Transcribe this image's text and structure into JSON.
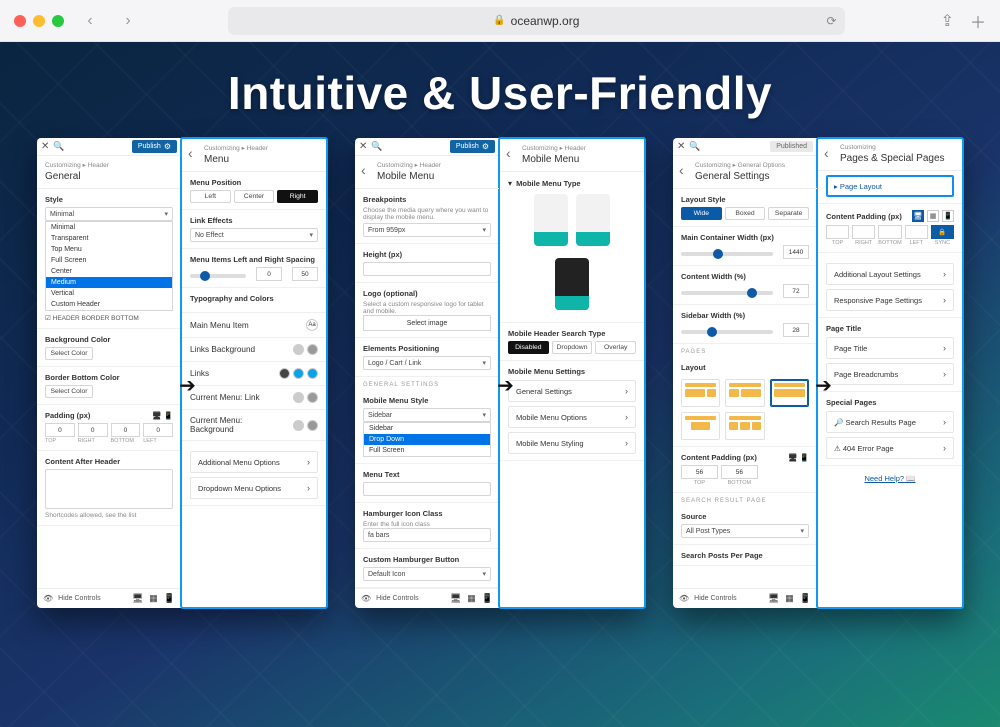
{
  "chrome": {
    "url_host": "oceanwp.org"
  },
  "hero": "Intuitive & User-Friendly",
  "board1": {
    "left": {
      "publish": "Publish",
      "crumb_path": "Customizing ▸ Header",
      "crumb_title": "General",
      "style_label": "Style",
      "style_value": "Minimal",
      "style_options": [
        "Minimal",
        "Transparent",
        "Top Menu",
        "Full Screen",
        "Center",
        "Medium",
        "Vertical",
        "Custom Header"
      ],
      "style_selected": "Medium",
      "checkbox": "HEADER BORDER BOTTOM",
      "bg_label": "Background Color",
      "bg_btn": "Select Color",
      "bb_label": "Border Bottom Color",
      "bb_btn": "Select Color",
      "pad_label": "Padding (px)",
      "pad_values": [
        "0",
        "0",
        "0",
        "0"
      ],
      "pad_sides": [
        "TOP",
        "RIGHT",
        "BOTTOM",
        "LEFT"
      ],
      "after_header": "Content After Header",
      "shortcodes": "Shortcodes allowed, see the list"
    },
    "right": {
      "crumb_path": "Customizing ▸ Header",
      "crumb_title": "Menu",
      "pos_label": "Menu Position",
      "pos_options": [
        "Left",
        "Center",
        "Right"
      ],
      "link_eff": "Link Effects",
      "link_eff_value": "No Effect",
      "spacing": "Menu Items Left and Right Spacing",
      "spacing_min": "0",
      "spacing_max": "50",
      "typo": "Typography and Colors",
      "main_item": "Main Menu Item",
      "links_bg": "Links Background",
      "links": "Links",
      "cur_link": "Current Menu: Link",
      "cur_bg": "Current Menu: Background",
      "add_menu": "Additional Menu Options",
      "drop_menu": "Dropdown Menu Options"
    },
    "footer": "Hide Controls"
  },
  "board2": {
    "left": {
      "publish": "Publish",
      "crumb_path": "Customizing ▸ Header",
      "crumb_title": "Mobile Menu",
      "break_label": "Breakpoints",
      "break_desc": "Choose the media query where you want to display the mobile menu.",
      "break_value": "From 959px",
      "height": "Height (px)",
      "logo": "Logo (optional)",
      "logo_desc": "Select a custom responsive logo for tablet and mobile.",
      "logo_btn": "Select image",
      "elem_pos": "Elements Positioning",
      "elem_value": "Logo / Cart / Link",
      "general": "GENERAL SETTINGS",
      "style_label": "Mobile Menu Style",
      "style_value": "Sidebar",
      "style_options": [
        "Sidebar",
        "Drop Down",
        "Full Screen"
      ],
      "style_selected": "Drop Down",
      "menu_text": "Menu Text",
      "ham": "Hamburger Icon Class",
      "ham_desc": "Enter the full icon class",
      "ham_value": "fa bars",
      "custom_ham": "Custom Hamburger Button",
      "custom_ham_value": "Default Icon"
    },
    "right": {
      "crumb_path": "Customizing ▸ Header",
      "crumb_title": "Mobile Menu",
      "menu_type": "Mobile Menu Type",
      "search_type": "Mobile Header Search Type",
      "search_opts": [
        "Disabled",
        "Dropdown",
        "Overlay"
      ],
      "settings": "Mobile Menu Settings",
      "links": [
        "General Settings",
        "Mobile Menu Options",
        "Mobile Menu Styling"
      ]
    },
    "footer": "Hide Controls"
  },
  "board3": {
    "left": {
      "published": "Published",
      "crumb_path": "Customizing ▸ General Options",
      "crumb_title": "General Settings",
      "layout_style": "Layout Style",
      "layout_opts": [
        "Wide",
        "Boxed",
        "Separate"
      ],
      "main_w": "Main Container Width (px)",
      "main_w_val": "1440",
      "cont_w": "Content Width (%)",
      "cont_w_val": "72",
      "side_w": "Sidebar Width (%)",
      "side_w_val": "28",
      "pages": "PAGES",
      "layout": "Layout",
      "pad": "Content Padding (px)",
      "pad_vals": [
        "56",
        "56"
      ],
      "pad_sides": [
        "TOP",
        "BOTTOM"
      ],
      "search_page": "SEARCH RESULT PAGE",
      "source": "Source",
      "source_val": "All Post Types",
      "posts_per": "Search Posts Per Page"
    },
    "right": {
      "crumb": "Customizing",
      "title": "Pages & Special Pages",
      "page_layout": "Page Layout",
      "content_pad": "Content Padding (px)",
      "pad_headers": [
        "Top",
        "Right",
        "Bottom",
        "Left",
        "Sync"
      ],
      "add_layout": "Additional Layout Settings",
      "resp": "Responsive Page Settings",
      "pt": "Page Title",
      "pt_links": [
        "Page Title",
        "Page Breadcrumbs"
      ],
      "special": "Special Pages",
      "special_links": [
        "Search Results Page",
        "404 Error Page"
      ],
      "help": "Need Help?"
    },
    "footer": "Hide Controls"
  }
}
